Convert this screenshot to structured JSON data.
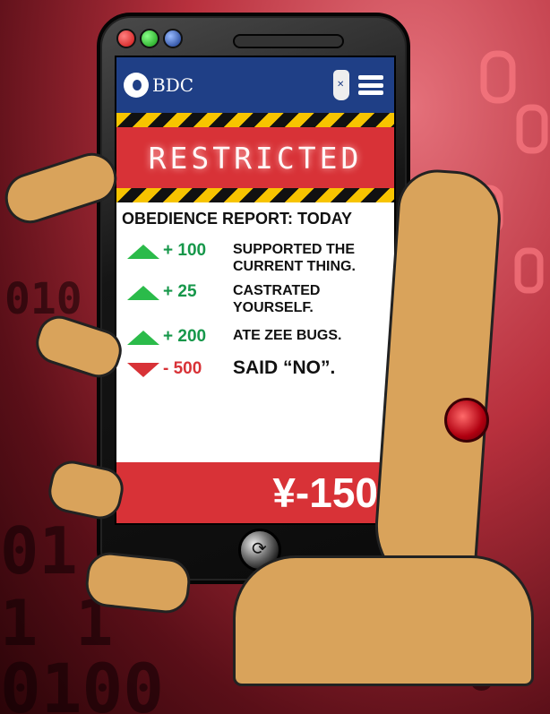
{
  "colors": {
    "accent_red": "#d83237",
    "nav_blue": "#1f3f86",
    "green": "#2bbb4a"
  },
  "app": {
    "logo_text": "BDC"
  },
  "banner": {
    "label": "RESTRICTED"
  },
  "report": {
    "title": "OBEDIENCE REPORT: TODAY",
    "entries": [
      {
        "direction": "up",
        "delta": "+ 100",
        "reason": "SUPPORTED THE CURRENT THING."
      },
      {
        "direction": "up",
        "delta": "+ 25",
        "reason": "CASTRATED YOURSELF."
      },
      {
        "direction": "up",
        "delta": "+ 200",
        "reason": "ATE ZEE BUGS."
      },
      {
        "direction": "down",
        "delta": "- 500",
        "reason": "SAID “NO”."
      }
    ]
  },
  "balance": {
    "value": "¥-150"
  },
  "icons": {
    "logo": "gear-logo-icon",
    "hand": "hand-icon",
    "menu": "menu-icon",
    "home": "home-button-icon"
  }
}
